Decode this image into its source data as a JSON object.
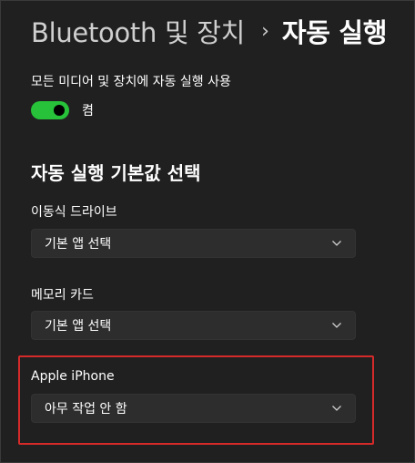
{
  "header": {
    "parent": "Bluetooth 및 장치",
    "separator": "›",
    "current": "자동 실행"
  },
  "autoplay_toggle": {
    "label": "모든 미디어 및 장치에 자동 실행 사용",
    "state_label": "켬",
    "on": true
  },
  "section": {
    "title": "자동 실행 기본값 선택"
  },
  "fields": [
    {
      "label": "이동식 드라이브",
      "value": "기본 앱 선택"
    },
    {
      "label": "메모리 카드",
      "value": "기본 앱 선택"
    },
    {
      "label": "Apple iPhone",
      "value": "아무 작업 안 함"
    }
  ],
  "colors": {
    "toggle_on": "#27c13a",
    "highlight_border": "#d62a2a",
    "background": "#202020"
  }
}
